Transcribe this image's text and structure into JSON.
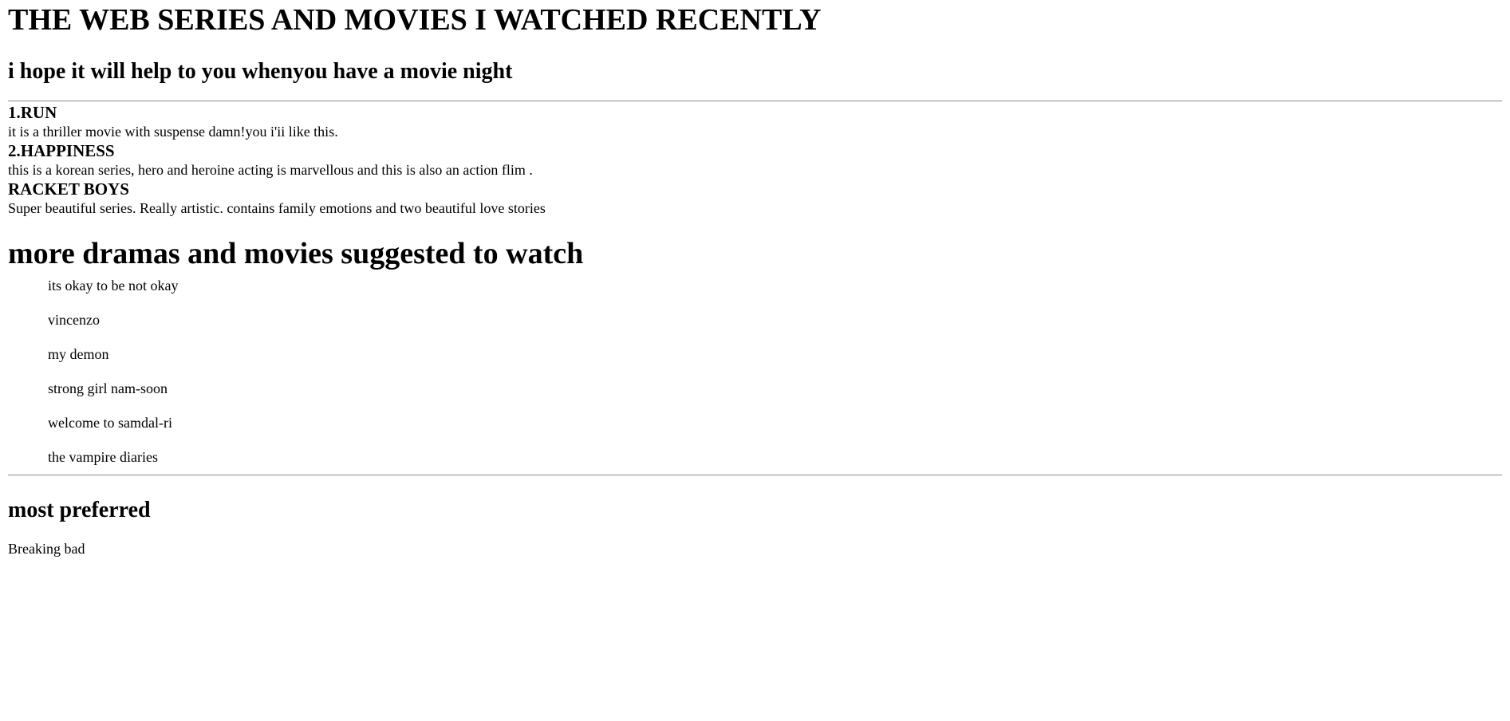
{
  "header": {
    "title": "THE WEB SERIES AND MOVIES I WATCHED RECENTLY",
    "subtitle": "i hope it will help to you whenyou have a movie night"
  },
  "entries": [
    {
      "title": "1.RUN",
      "description": "it is a thriller movie with suspense damn!you i'ii like this."
    },
    {
      "title": "2.HAPPINESS",
      "description": "this is a korean series, hero and heroine acting is marvellous and this is also an action flim ."
    },
    {
      "title": "RACKET BOYS",
      "description": "Super beautiful series. Really artistic. contains family emotions and two beautiful love stories"
    }
  ],
  "suggestions": {
    "title": "more dramas and movies suggested to watch",
    "items": [
      "its okay to be not okay",
      "vincenzo",
      "my demon",
      "strong girl nam-soon",
      "welcome to samdal-ri",
      "the vampire diaries"
    ]
  },
  "preferred": {
    "title": "most preferred",
    "item": "Breaking bad"
  }
}
